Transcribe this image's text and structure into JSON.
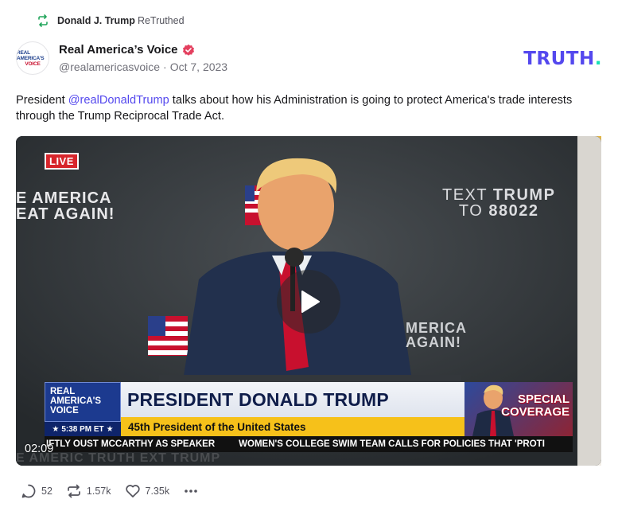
{
  "retruth": {
    "name": "Donald J. Trump",
    "action": "ReTruthed"
  },
  "author": {
    "display_name": "Real America’s Voice",
    "handle": "@realamericasvoice",
    "date": "Oct 7, 2023",
    "avatar_line1": "REAL AMERICA'S",
    "avatar_line2": "VOICE",
    "verified": true
  },
  "brand": {
    "logo_text": "TRUTH",
    "logo_dot": ".",
    "color": "#5448ee",
    "accent": "#17e0b5"
  },
  "post": {
    "text_before": "President ",
    "mention": "@realDonaldTrump",
    "text_after": " talks about how his Administration is going to protect America's trade interests through the Trump Reciprocal Trade Act."
  },
  "video": {
    "live_badge": "LIVE",
    "duration": "02:09",
    "slogan_left_1": "E AMERICA",
    "slogan_left_2": "EAT AGAIN!",
    "slogan_right_1a": "TEXT ",
    "slogan_right_1b": "TRUMP",
    "slogan_right_2a": "TO ",
    "slogan_right_2b": "88022",
    "slogan_mid_1": "MERICA",
    "slogan_mid_2": "AGAIN!",
    "lower_third": {
      "logo_line1": "REAL",
      "logo_line2": "AMERICA'S",
      "logo_line3": "VOICE",
      "time": "5:38 PM ET",
      "headline": "PRESIDENT DONALD TRUMP",
      "subline": "45th President of the United States",
      "special_1": "SPECIAL",
      "special_2": "COVERAGE"
    },
    "ticker_1": "IFTLY OUST MCCARTHY AS SPEAKER",
    "ticker_2": "WOMEN'S COLLEGE SWIM TEAM CALLS FOR POLICIES THAT 'PROTI",
    "bottom_text": "E AMERIC                                              TRUTH                                   EXT TRUMP"
  },
  "actions": {
    "replies": "52",
    "retruths": "1.57k",
    "likes": "7.35k"
  }
}
